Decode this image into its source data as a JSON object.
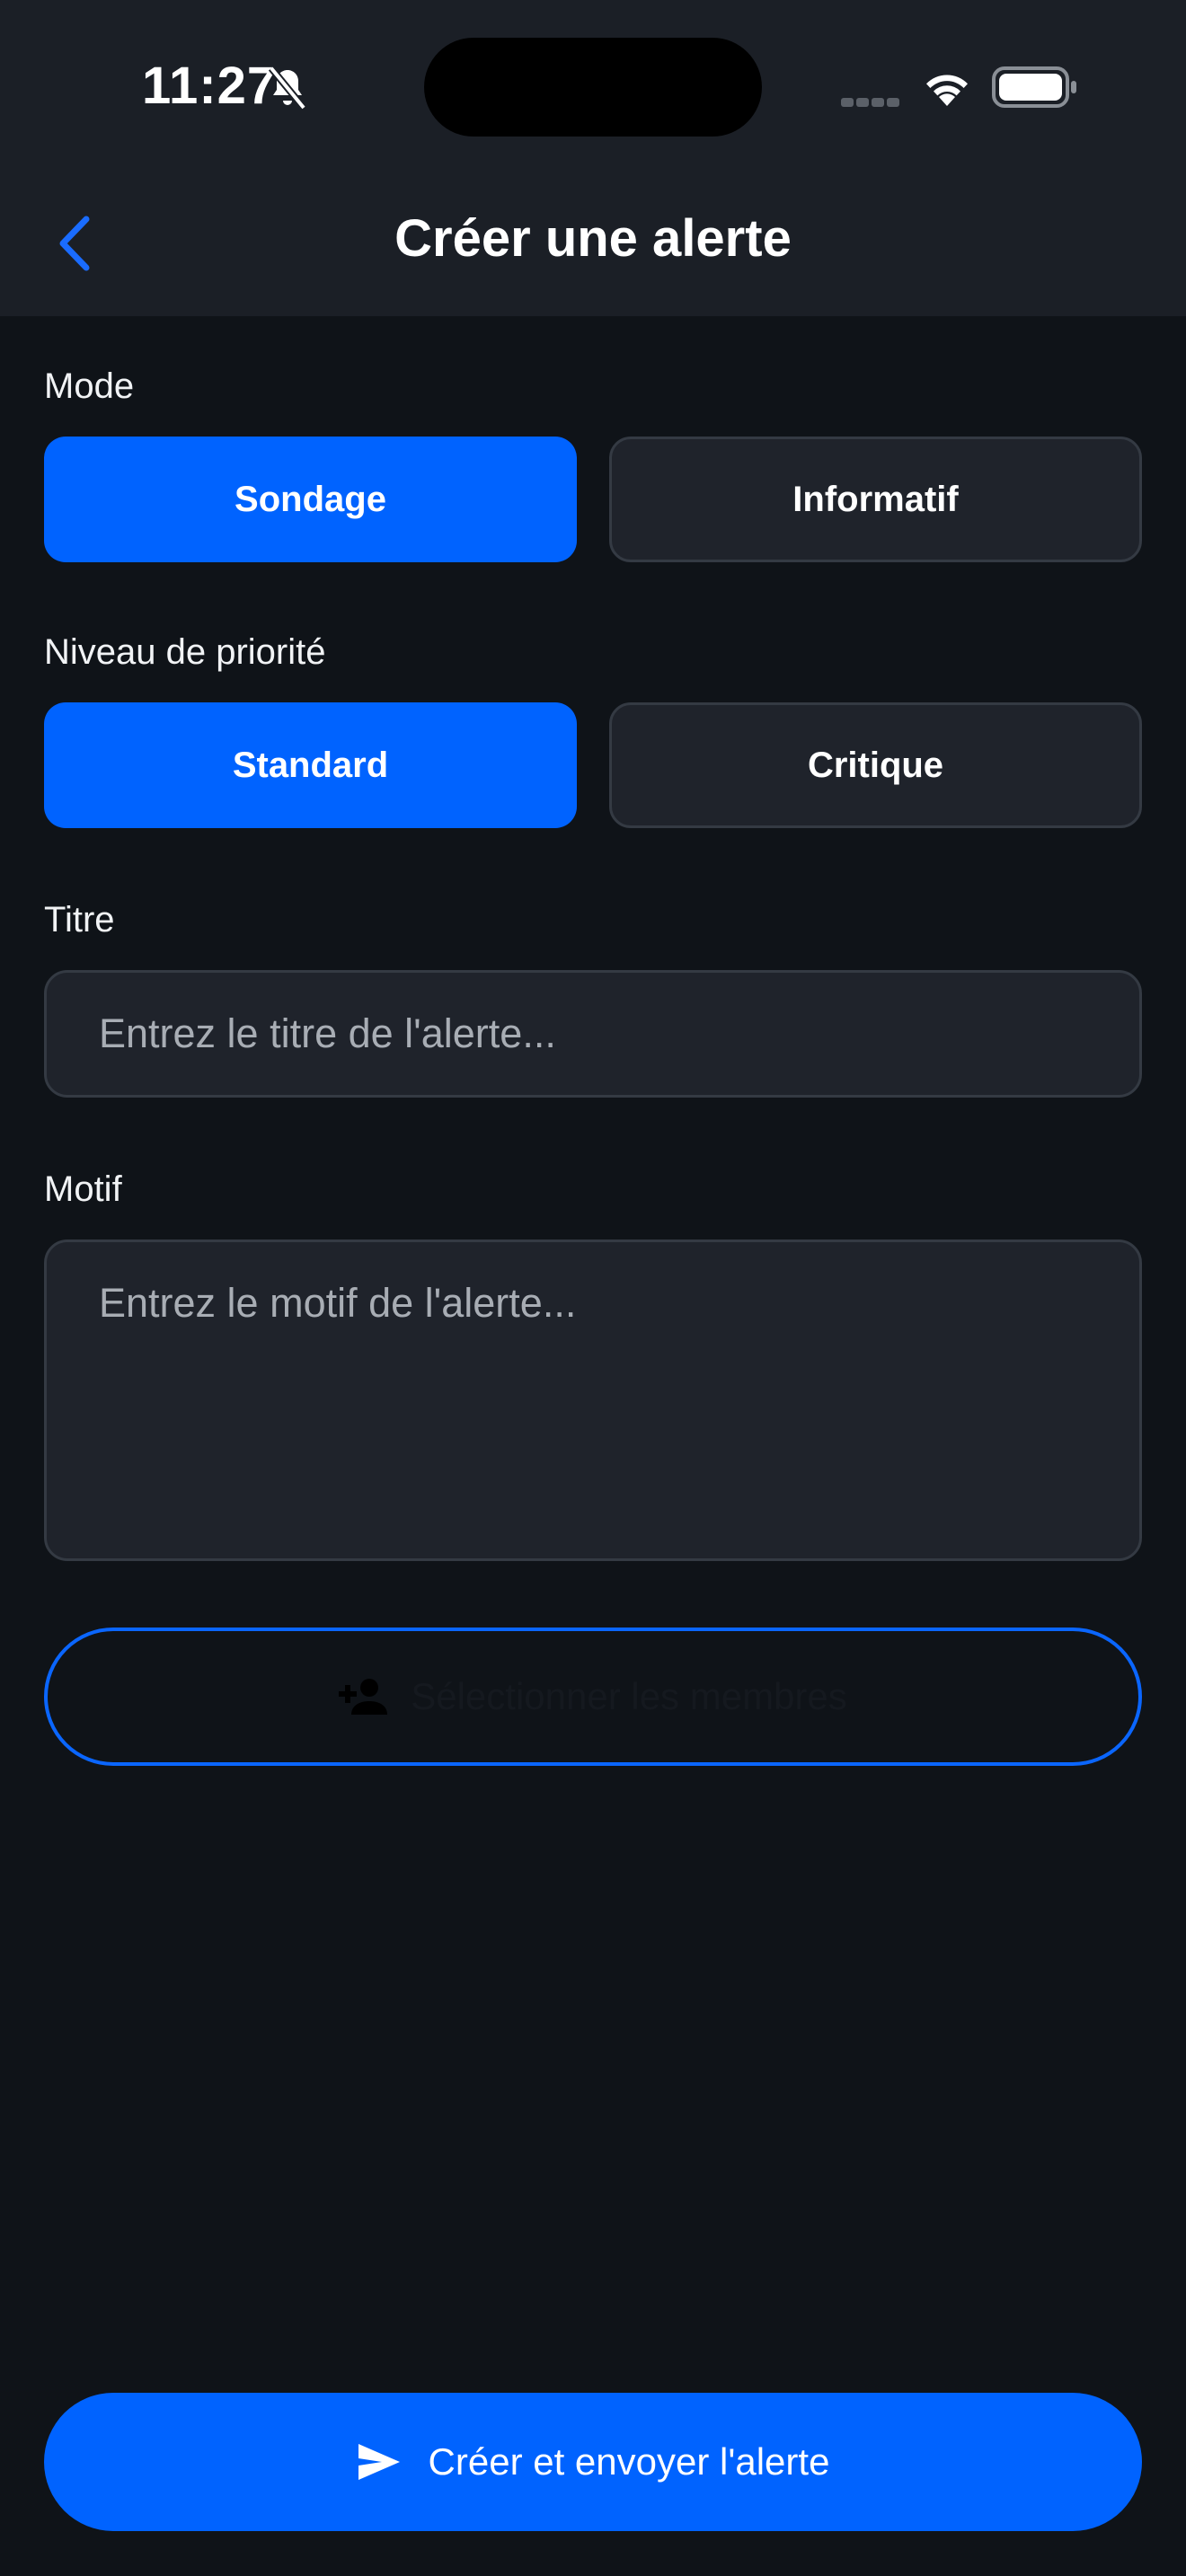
{
  "status_bar": {
    "time": "11:27"
  },
  "header": {
    "title": "Créer une alerte"
  },
  "mode": {
    "label": "Mode",
    "options": [
      {
        "label": "Sondage",
        "selected": true
      },
      {
        "label": "Informatif",
        "selected": false
      }
    ]
  },
  "priority": {
    "label": "Niveau de priorité",
    "options": [
      {
        "label": "Standard",
        "selected": true
      },
      {
        "label": "Critique",
        "selected": false
      }
    ]
  },
  "title_field": {
    "label": "Titre",
    "placeholder": "Entrez le titre de l'alerte...",
    "value": ""
  },
  "reason_field": {
    "label": "Motif",
    "placeholder": "Entrez le motif de l'alerte...",
    "value": ""
  },
  "members_button": {
    "label": "Sélectionner les membres",
    "icon": "person-add-icon"
  },
  "submit_button": {
    "label": "Créer et envoyer l'alerte",
    "icon": "send-icon"
  },
  "colors": {
    "accent": "#0063ff",
    "background": "#0f1318",
    "surface": "#1f232b",
    "header": "#1b1f26"
  }
}
